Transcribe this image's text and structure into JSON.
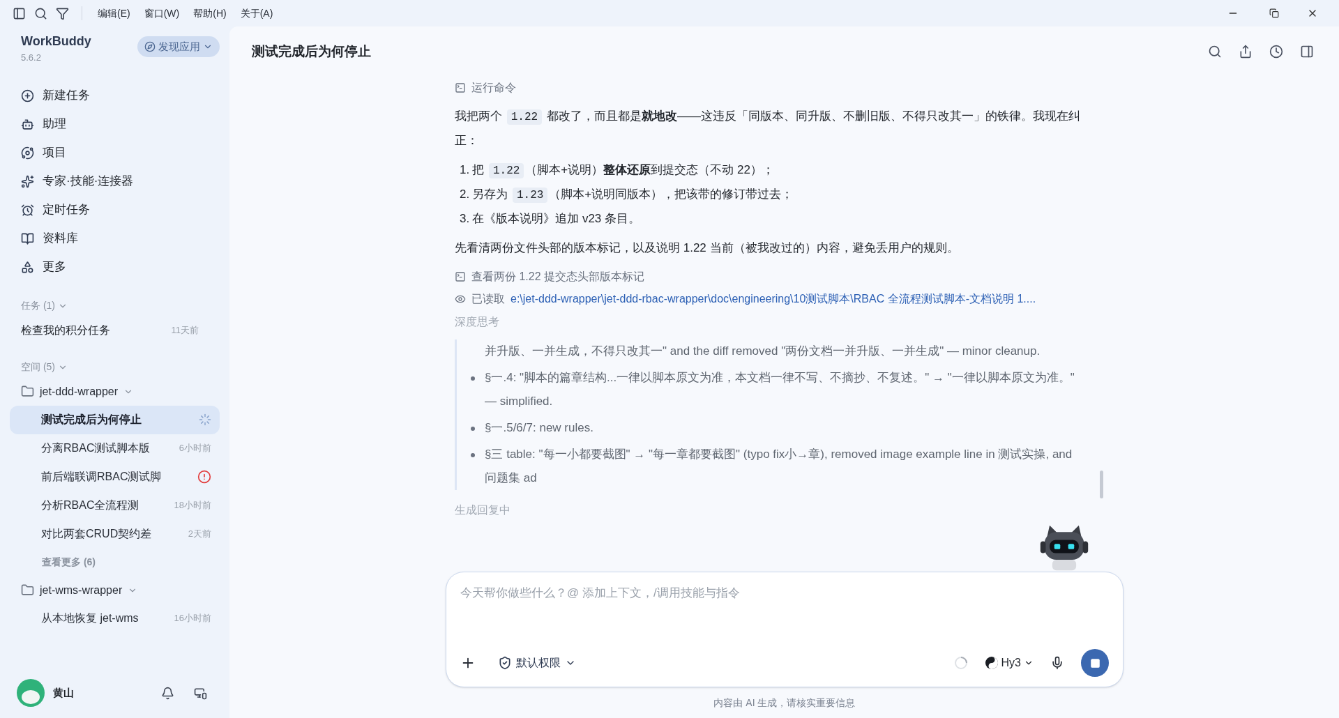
{
  "menu_bar": {
    "items": [
      "编辑(E)",
      "窗口(W)",
      "帮助(H)",
      "关于(A)"
    ]
  },
  "sidebar": {
    "app_name": "WorkBuddy",
    "version": "5.6.2",
    "discover_button": "发现应用",
    "nav": [
      {
        "kind": "new",
        "label": "新建任务"
      },
      {
        "kind": "assistant",
        "label": "助理"
      },
      {
        "kind": "project",
        "label": "项目"
      },
      {
        "kind": "expert",
        "label": "专家·技能·连接器"
      },
      {
        "kind": "schedule",
        "label": "定时任务"
      },
      {
        "kind": "library",
        "label": "资料库"
      },
      {
        "kind": "more",
        "label": "更多"
      }
    ],
    "tasks_section": {
      "label": "任务 (1)",
      "expanded": true,
      "items": [
        {
          "title": "检查我的积分任务",
          "time": "11天前"
        }
      ]
    },
    "spaces_section": {
      "label": "空间 (5)",
      "expanded": true,
      "spaces": [
        {
          "name": "jet-ddd-wrapper",
          "expanded": true,
          "items": [
            {
              "kind": "running",
              "title": "测试完成后为何停止",
              "selected": true
            },
            {
              "kind": "timed",
              "title": "分离RBAC测试脚本版",
              "time": "6小时前",
              "selected": false
            },
            {
              "kind": "error",
              "title": "前后端联调RBAC测试脚",
              "selected": false
            },
            {
              "kind": "timed",
              "title": "分析RBAC全流程测",
              "time": "18小时前",
              "selected": false
            },
            {
              "kind": "timed",
              "title": "对比两套CRUD契约差",
              "time": "2天前",
              "selected": false
            }
          ],
          "more": "查看更多 (6)"
        },
        {
          "name": "jet-wms-wrapper",
          "expanded": true,
          "items": [
            {
              "kind": "timed",
              "title": "从本地恢复 jet-wms",
              "time": "16小时前",
              "selected": false
            }
          ]
        }
      ]
    },
    "user": {
      "name": "黄山"
    }
  },
  "chat": {
    "title": "测试完成后为何停止",
    "blocks": [
      {
        "kind": "command_step",
        "label": "运行命令"
      },
      {
        "kind": "paragraph",
        "segments": [
          {
            "kind": "text",
            "text": "我把两个 "
          },
          {
            "kind": "code",
            "text": "1.22"
          },
          {
            "kind": "text",
            "text": " 都改了，而且都是**就地改**——这违反「同版本、同升版、不删旧版、不得只改其一」的铁律。我现在纠正："
          }
        ]
      },
      {
        "kind": "list_item",
        "marker": "1.",
        "segments": [
          {
            "kind": "text",
            "text": "把 "
          },
          {
            "kind": "code",
            "text": "1.22"
          },
          {
            "kind": "text",
            "text": "（脚本+说明）**整体还原**到提交态（不动 22）；"
          }
        ]
      },
      {
        "kind": "list_item",
        "marker": "2.",
        "segments": [
          {
            "kind": "text",
            "text": "另存为 "
          },
          {
            "kind": "code",
            "text": "1.23"
          },
          {
            "kind": "text",
            "text": "（脚本+说明同版本），把该带的修订带过去；"
          }
        ]
      },
      {
        "kind": "list_item",
        "marker": "3.",
        "segments": [
          {
            "kind": "text",
            "text": "在《版本说明》追加 v23 条目。"
          }
        ]
      },
      {
        "kind": "paragraph",
        "segments": [
          {
            "kind": "text",
            "text": "先看清两份文件头部的版本标记，以及说明 1.22 当前（被我改过的）内容，避免丢用户的规则。"
          }
        ]
      },
      {
        "kind": "command_step",
        "label": "查看两份 1.22 提交态头部版本标记"
      },
      {
        "kind": "read_step",
        "label": "已读取",
        "path": "e:\\jet-ddd-wrapper\\jet-ddd-rbac-wrapper\\doc\\engineering\\10测试脚本\\RBAC 全流程测试脚本-文档说明 1...."
      }
    ],
    "thinking": {
      "label": "深度思考",
      "items": [
        {
          "kind": "continuation",
          "text": "并升版、一并生成，不得只改其一\" and the diff removed \"两份文档一并升版、一并生成\" — minor cleanup."
        },
        {
          "kind": "bullet",
          "text": "§一.4: \"脚本的篇章结构...一律以脚本原文为准，本文档一律不写、不摘抄、不复述。\" → \"一律以脚本原文为准。\" — simplified."
        },
        {
          "kind": "bullet",
          "text": "§一.5/6/7: new rules."
        },
        {
          "kind": "bullet",
          "text": "§三 table: \"每一小都要截图\" → \"每一章都要截图\" (typo fix小→章), removed image example line in 测试实操, and 问题集 ad"
        }
      ]
    },
    "status": "生成回复中"
  },
  "composer": {
    "placeholder": "今天帮你做些什么？@ 添加上下文，/调用技能与指令",
    "permission": "默认权限",
    "model": "Hy3",
    "busy": true
  },
  "footer": "内容由 AI 生成，请核实重要信息"
}
